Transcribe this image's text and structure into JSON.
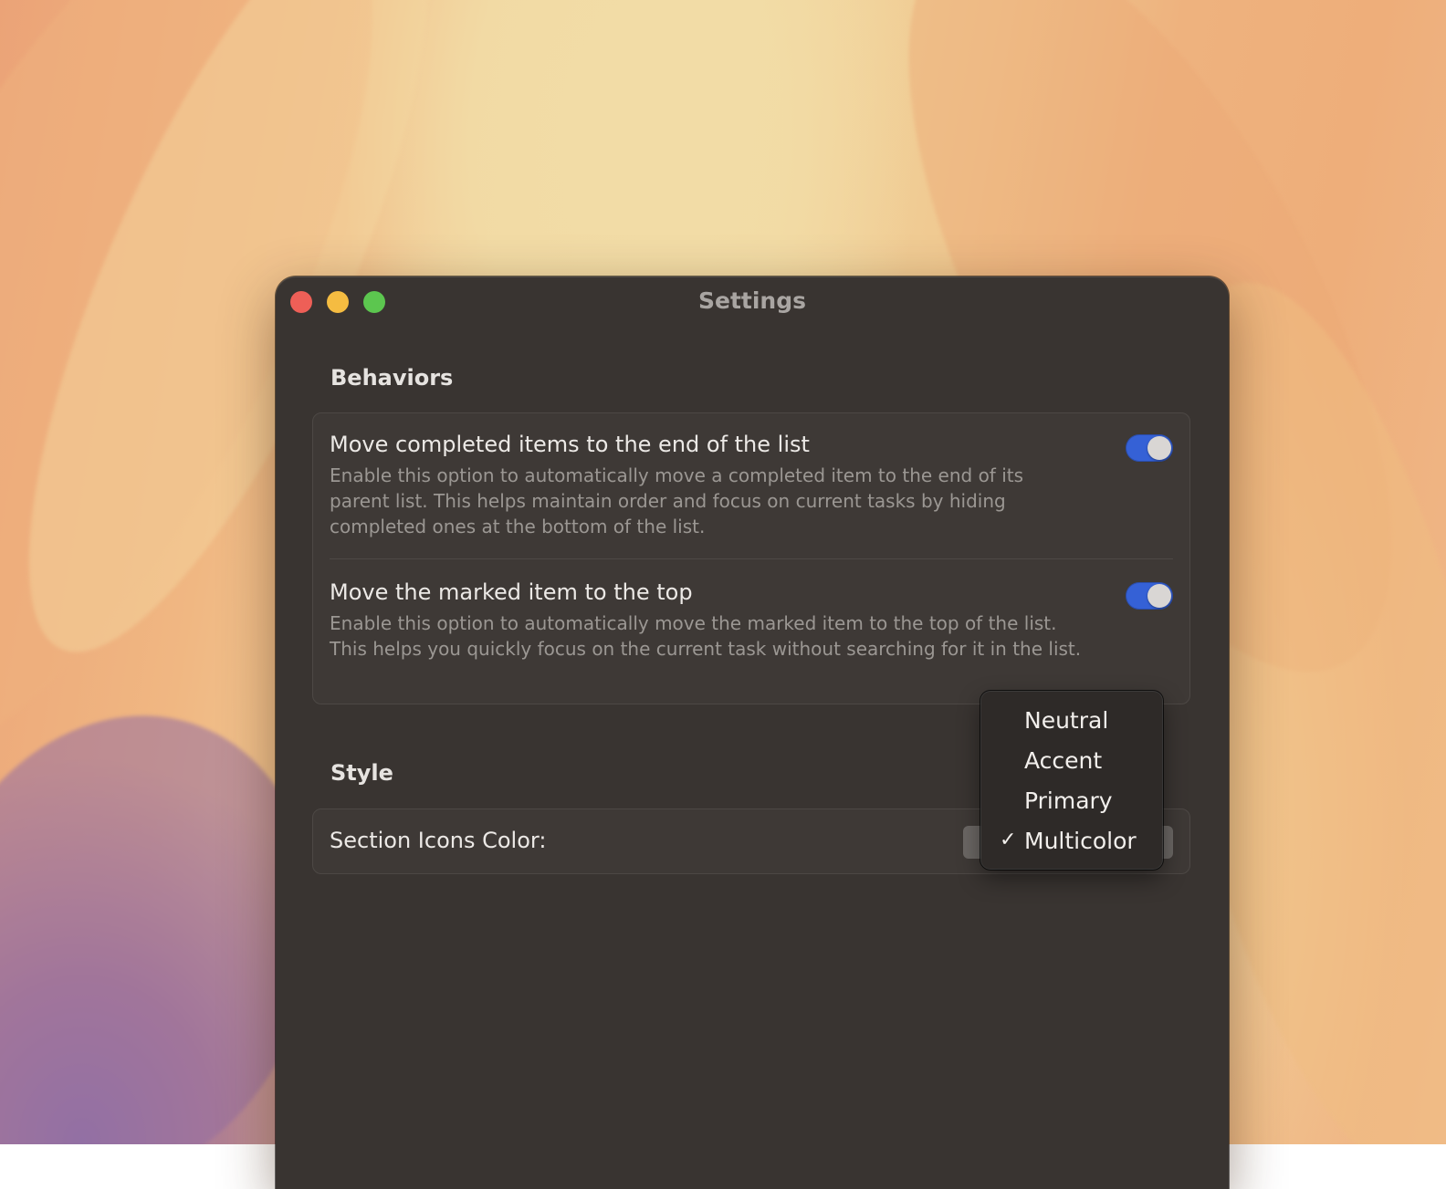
{
  "window": {
    "title": "Settings"
  },
  "behaviors": {
    "heading": "Behaviors",
    "items": [
      {
        "title": "Move completed items to the end of the list",
        "description": "Enable this option to automatically move a completed item to the end of its parent list. This helps maintain order and focus on current tasks by hiding completed ones at the bottom of the list.",
        "enabled": true
      },
      {
        "title": "Move the marked item to the top",
        "description": "Enable this option to automatically move the marked item to the top of the list. This helps you quickly focus on the current task without searching for it in the list.",
        "enabled": true
      }
    ]
  },
  "style": {
    "heading": "Style",
    "section_icons_color_label": "Section Icons Color:",
    "selected": "Multicolor",
    "options": [
      "Neutral",
      "Accent",
      "Primary",
      "Multicolor"
    ],
    "check_mark": "✓"
  },
  "colors": {
    "window_background": "#393431",
    "group_background": "#3e3936",
    "toggle_on": "#3561d6",
    "traffic_close": "#ee5f57",
    "traffic_minimize": "#f5bc41",
    "traffic_zoom": "#5cc64f"
  }
}
